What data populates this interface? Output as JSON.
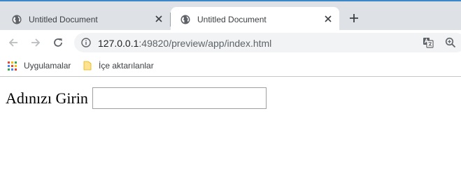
{
  "browser": {
    "tabs": [
      {
        "title": "Untitled Document",
        "active": false
      },
      {
        "title": "Untitled Document",
        "active": true
      }
    ],
    "new_tab_icon": "plus-icon",
    "accent_color": "#3b87c8"
  },
  "toolbar": {
    "url_host": "127.0.0.1",
    "url_rest": ":49820/preview/app/index.html"
  },
  "bookmarks": {
    "items": [
      {
        "label": "Uygulamalar",
        "icon": "apps-grid-icon"
      },
      {
        "label": "İçe aktarılanlar",
        "icon": "folder-icon"
      }
    ]
  },
  "page": {
    "name_label": "Adınızı Girin",
    "name_input_value": "",
    "name_input_placeholder": ""
  }
}
